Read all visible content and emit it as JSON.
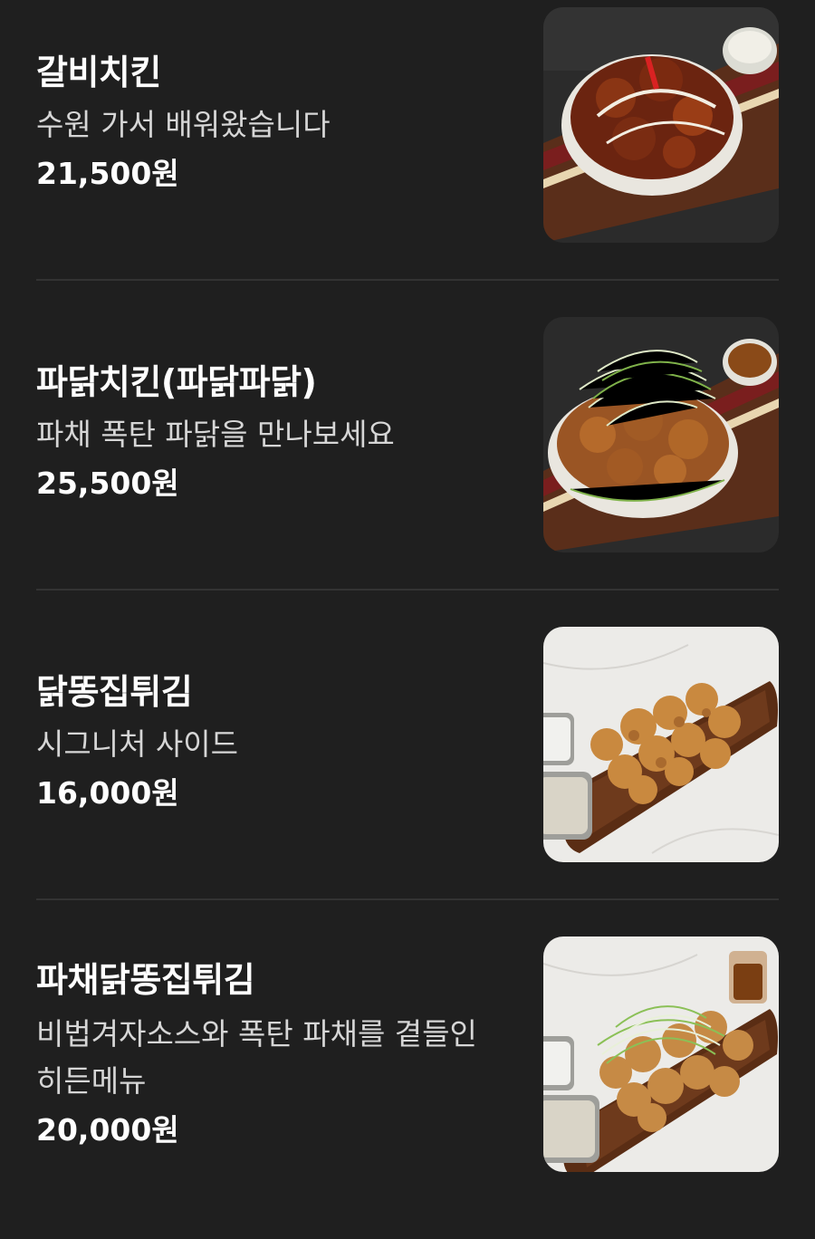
{
  "menu": {
    "items": [
      {
        "name": "갈비치킨",
        "description": "수원 가서 배워왔습니다",
        "price": "21,500원",
        "image_icon": "galbi-chicken-photo"
      },
      {
        "name": "파닭치킨(파닭파닭)",
        "description": "파채 폭탄 파닭을 만나보세요",
        "price": "25,500원",
        "image_icon": "padak-chicken-photo"
      },
      {
        "name": "닭똥집튀김",
        "description": "시그니처 사이드",
        "price": "16,000원",
        "image_icon": "fried-gizzard-photo"
      },
      {
        "name": "파채닭똥집튀김",
        "description": "비법겨자소스와 폭탄 파채를 곁들인 히든메뉴",
        "price": "20,000원",
        "image_icon": "green-onion-gizzard-photo"
      }
    ]
  },
  "colors": {
    "background": "#1f1f1f",
    "text_primary": "#ffffff",
    "text_secondary": "#d6d6d6",
    "divider": "#333333"
  }
}
